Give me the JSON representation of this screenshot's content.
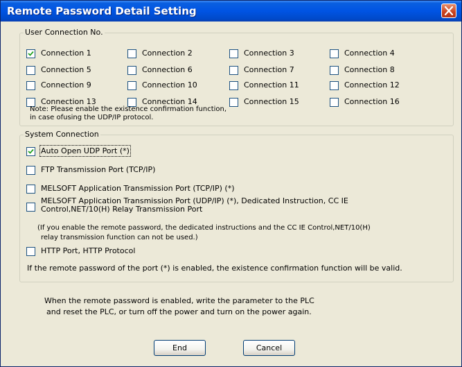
{
  "window": {
    "title": "Remote Password Detail Setting"
  },
  "user_connection": {
    "legend": "User Connection No.",
    "connections": [
      {
        "label": "Connection 1",
        "checked": true
      },
      {
        "label": "Connection 2",
        "checked": false
      },
      {
        "label": "Connection 3",
        "checked": false
      },
      {
        "label": "Connection 4",
        "checked": false
      },
      {
        "label": "Connection 5",
        "checked": false
      },
      {
        "label": "Connection 6",
        "checked": false
      },
      {
        "label": "Connection 7",
        "checked": false
      },
      {
        "label": "Connection 8",
        "checked": false
      },
      {
        "label": "Connection 9",
        "checked": false
      },
      {
        "label": "Connection 10",
        "checked": false
      },
      {
        "label": "Connection 11",
        "checked": false
      },
      {
        "label": "Connection 12",
        "checked": false
      },
      {
        "label": "Connection 13",
        "checked": false
      },
      {
        "label": "Connection 14",
        "checked": false
      },
      {
        "label": "Connection 15",
        "checked": false
      },
      {
        "label": "Connection 16",
        "checked": false
      }
    ],
    "note_line1": "Note: Please enable the existence confirmation function,",
    "note_line2": "in case ofusing the UDP/IP protocol."
  },
  "system_connection": {
    "legend": "System Connection",
    "items": [
      {
        "label": "Auto Open UDP Port (*)",
        "checked": true
      },
      {
        "label": "FTP Transmission Port (TCP/IP)",
        "checked": false
      },
      {
        "label": "MELSOFT Application Transmission Port (TCP/IP) (*)",
        "checked": false
      },
      {
        "label": "MELSOFT Application Transmission Port (UDP/IP) (*), Dedicated Instruction, CC IE Control,NET/10(H) Relay Transmission Port",
        "checked": false
      },
      {
        "label": "HTTP Port, HTTP Protocol",
        "checked": false
      }
    ],
    "remark_line1": "(If you enable the remote password, the dedicated instructions and the CC IE Control,NET/10(H)",
    "remark_line2": "relay transmission function can not be used.)",
    "footer": "If the remote password of the port (*) is enabled, the existence confirmation function will be valid."
  },
  "bottom_note": {
    "line1": "When the remote password is enabled, write the parameter to the PLC",
    "line2": "and reset the PLC, or turn off the power and turn on the power again."
  },
  "buttons": {
    "end": "End",
    "cancel": "Cancel"
  }
}
